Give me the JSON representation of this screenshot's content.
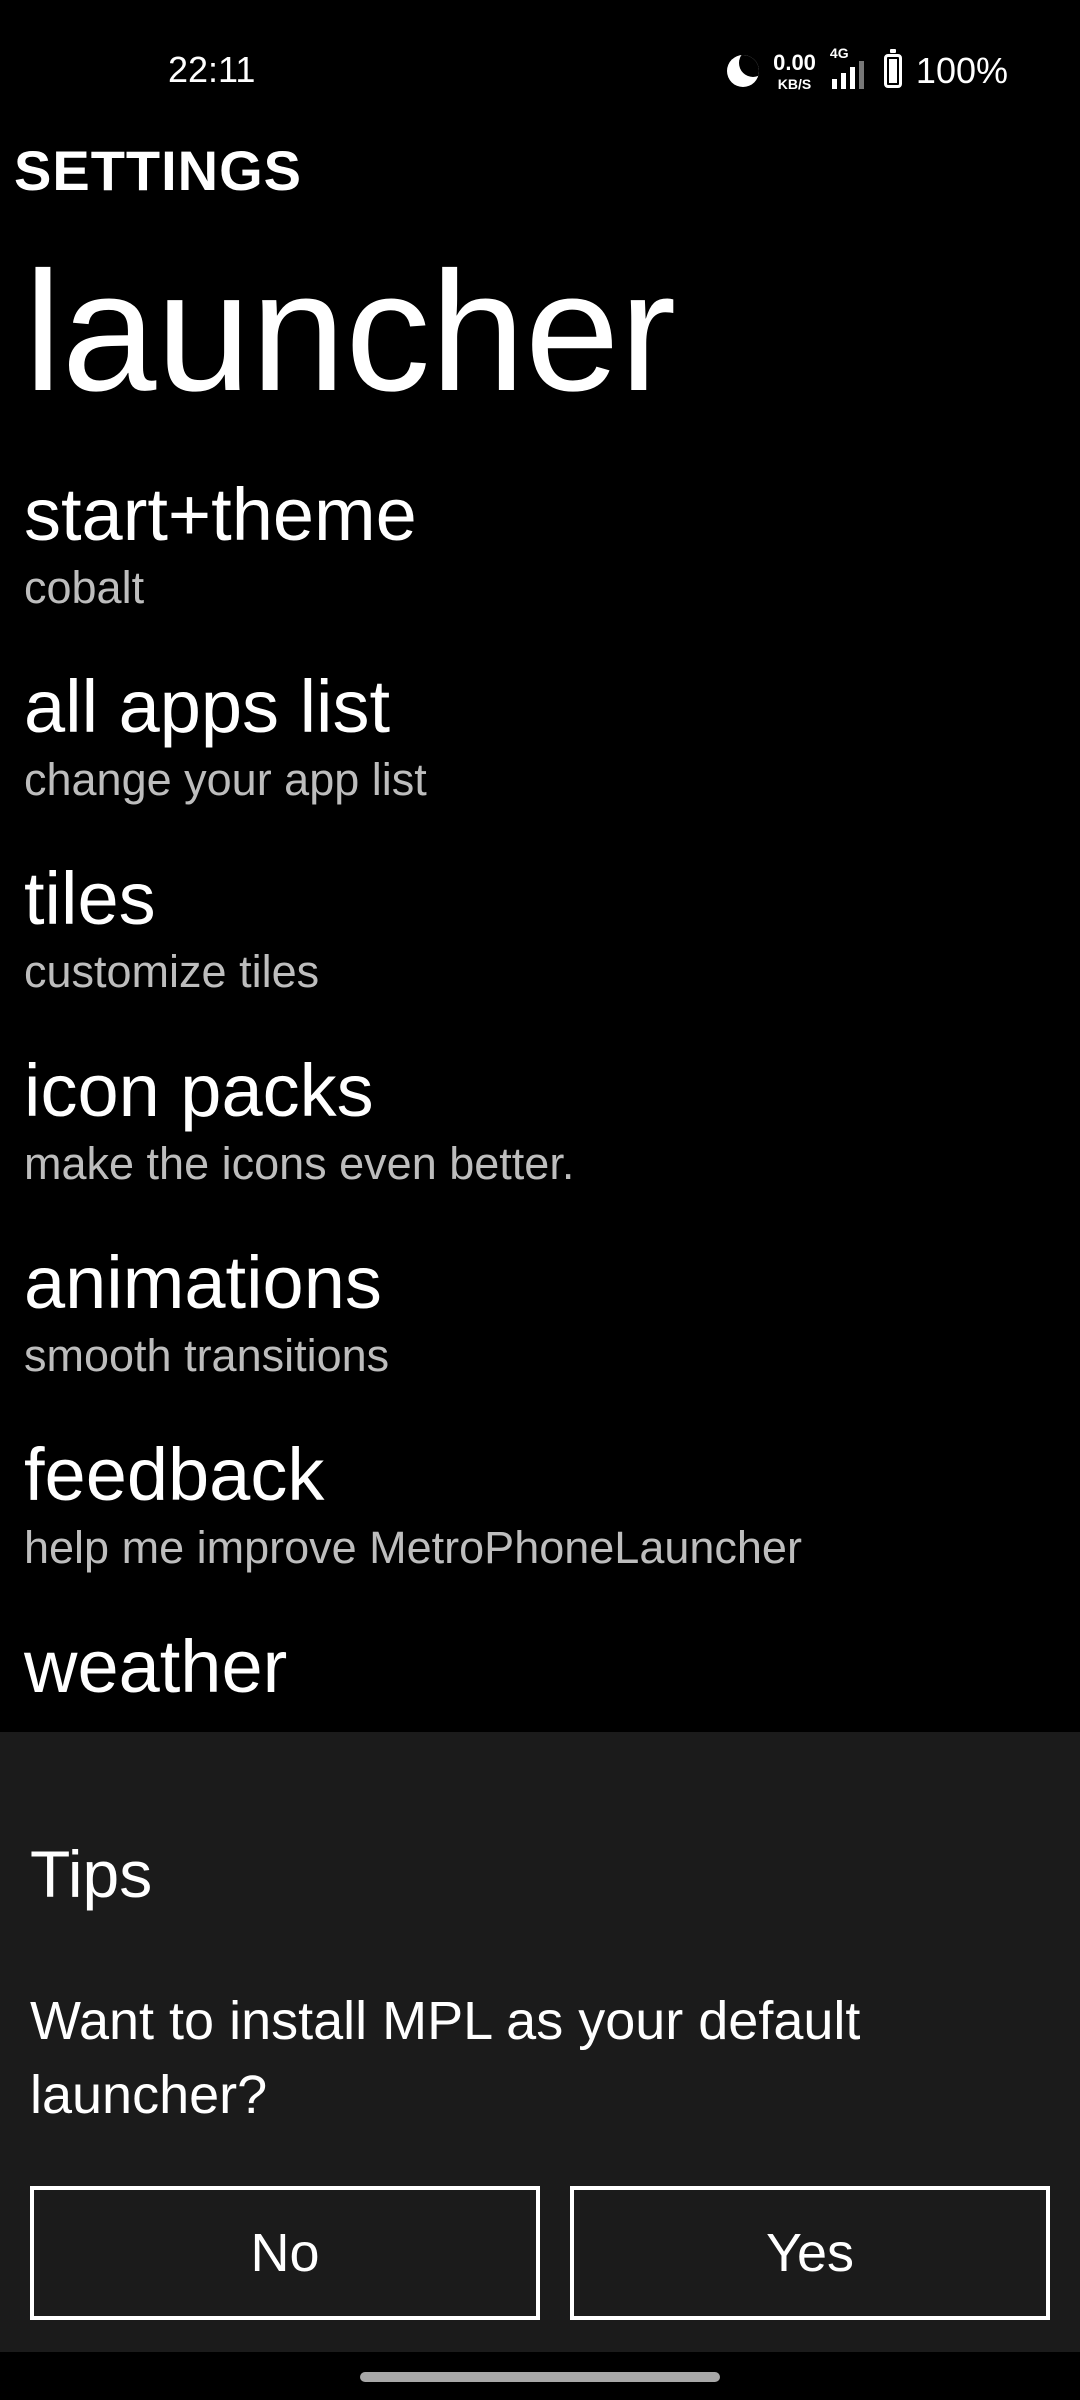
{
  "status_bar": {
    "time": "22:11",
    "net_speed_value": "0.00",
    "net_speed_unit": "KB/S",
    "network_type": "4G",
    "battery_percent": "100%",
    "battery_level": 1.0,
    "icons": [
      "moon-icon",
      "signal-icon",
      "battery-icon"
    ]
  },
  "header": {
    "section_label": "SETTINGS",
    "title": "launcher"
  },
  "settings": {
    "items": [
      {
        "title": "start+theme",
        "subtitle": "cobalt"
      },
      {
        "title": "all apps list",
        "subtitle": "change your app list"
      },
      {
        "title": "tiles",
        "subtitle": "customize tiles"
      },
      {
        "title": "icon packs",
        "subtitle": "make the icons even better."
      },
      {
        "title": "animations",
        "subtitle": "smooth transitions"
      },
      {
        "title": "feedback",
        "subtitle": "help me improve MetroPhoneLauncher"
      },
      {
        "title": "weather"
      }
    ]
  },
  "tips": {
    "title": "Tips",
    "message": "Want to install MPL as your default launcher?",
    "no_label": "No",
    "yes_label": "Yes"
  },
  "colors": {
    "background": "#000000",
    "sheet_background": "#1b1b1b",
    "text_primary": "#ffffff",
    "text_secondary": "#bdbdbd"
  }
}
